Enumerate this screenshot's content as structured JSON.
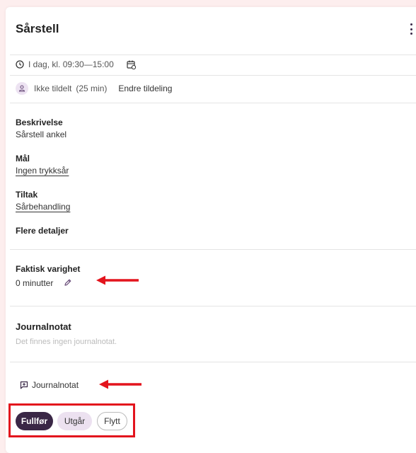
{
  "task": {
    "title": "Sårstell",
    "time": "I dag, kl. 09:30—15:00",
    "assignee": "Ikke tildelt",
    "duration_est": "(25 min)",
    "change_assignment": "Endre tildeling"
  },
  "details": {
    "description_label": "Beskrivelse",
    "description_value": "Sårstell ankel",
    "goal_label": "Mål",
    "goal_value": "Ingen trykksår",
    "action_label": "Tiltak",
    "action_value": "Sårbehandling",
    "more_details": "Flere detaljer"
  },
  "duration": {
    "label": "Faktisk varighet",
    "value": "0 minutter"
  },
  "journal": {
    "title": "Journalnotat",
    "empty_text": "Det finnes ingen journalnotat.",
    "add_label": "Journalnotat"
  },
  "actions": {
    "complete": "Fullfør",
    "cancel": "Utgår",
    "move": "Flytt"
  },
  "colors": {
    "primary": "#3a2746",
    "secondary": "#ece1f0",
    "highlight_red": "#e3141d",
    "page_bg": "#fdeeee"
  },
  "icons": [
    "kebab-menu-icon",
    "clock-icon",
    "calendar-icon",
    "user-icon",
    "pencil-icon",
    "note-plus-icon",
    "arrow-left-icon"
  ]
}
